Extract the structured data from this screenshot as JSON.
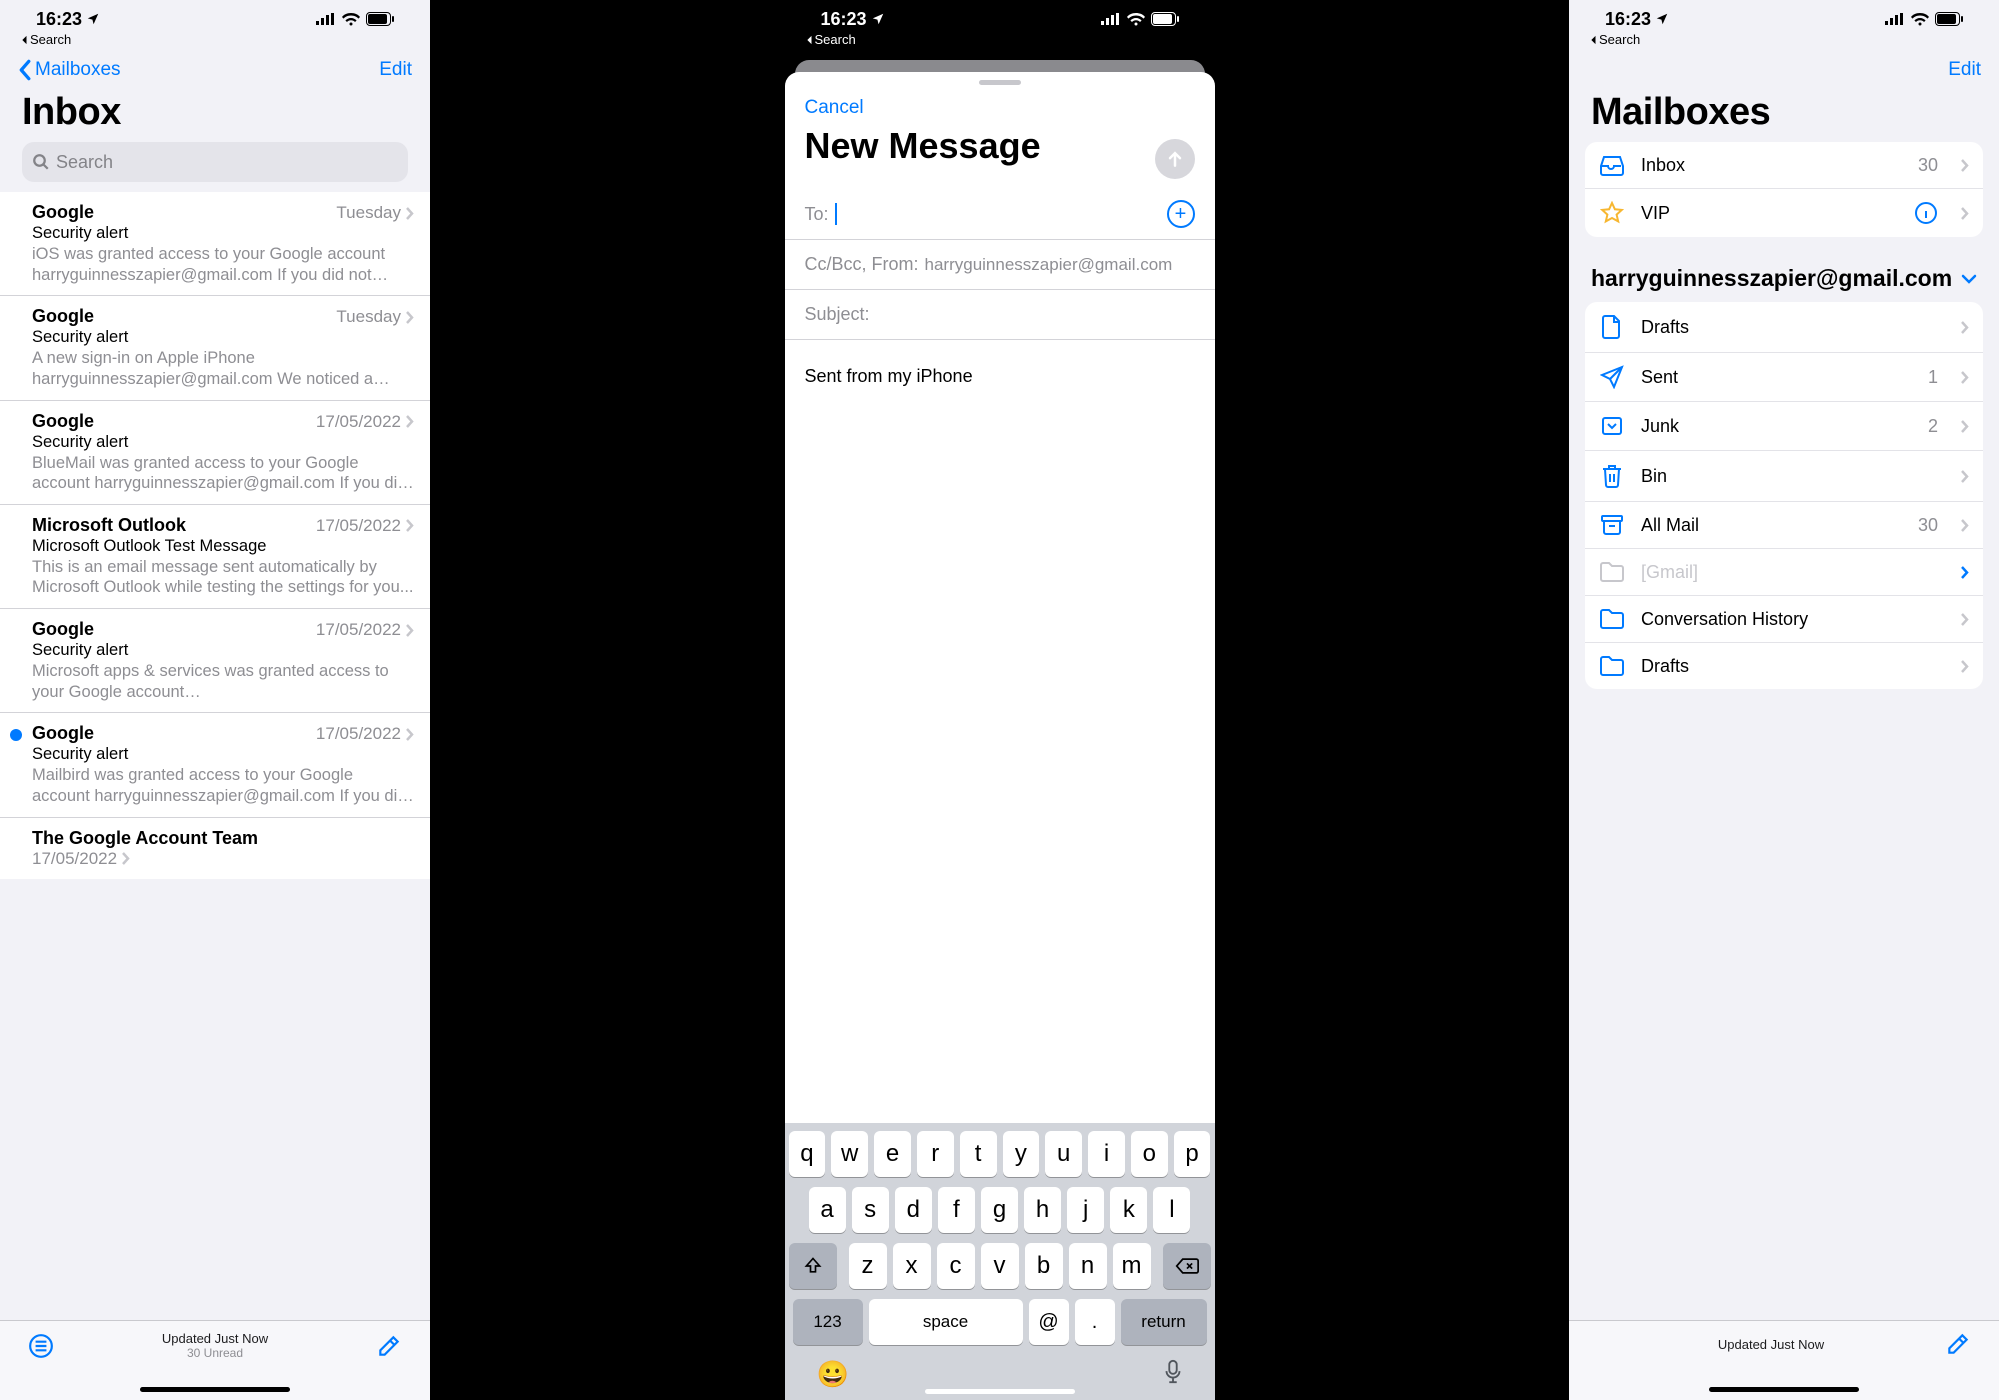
{
  "status": {
    "time": "16:23",
    "back": "Search"
  },
  "inbox": {
    "back": "Mailboxes",
    "edit": "Edit",
    "title": "Inbox",
    "search_placeholder": "Search",
    "toolbar": {
      "status": "Updated Just Now",
      "sub": "30 Unread"
    },
    "rows": [
      {
        "unread": false,
        "sender": "Google",
        "date": "Tuesday",
        "subject": "Security alert",
        "preview": "iOS was granted access to your Google account harryguinnesszapier@gmail.com If you did not gran..."
      },
      {
        "unread": false,
        "sender": "Google",
        "date": "Tuesday",
        "subject": "Security alert",
        "preview": "A new sign-in on Apple iPhone harryguinnesszapier@gmail.com We noticed a new..."
      },
      {
        "unread": false,
        "sender": "Google",
        "date": "17/05/2022",
        "subject": "Security alert",
        "preview": "BlueMail was granted access to your Google account harryguinnesszapier@gmail.com If you did not gran..."
      },
      {
        "unread": false,
        "sender": "Microsoft Outlook",
        "date": "17/05/2022",
        "subject": "Microsoft Outlook Test Message",
        "preview": "This is an email message sent automatically by Microsoft Outlook while testing the settings for you..."
      },
      {
        "unread": false,
        "sender": "Google",
        "date": "17/05/2022",
        "subject": "Security alert",
        "preview": "Microsoft apps & services was granted access to your Google account harryguinnesszapier@gmail.c..."
      },
      {
        "unread": true,
        "sender": "Google",
        "date": "17/05/2022",
        "subject": "Security alert",
        "preview": "Mailbird was granted access to your Google account harryguinnesszapier@gmail.com If you did not gran..."
      },
      {
        "unread": false,
        "sender": "The Google Account Team",
        "date": "17/05/2022",
        "subject": "",
        "preview": ""
      }
    ]
  },
  "compose": {
    "cancel": "Cancel",
    "title": "New Message",
    "to_label": "To:",
    "cc_label": "Cc/Bcc, From:",
    "from_value": "harryguinnesszapier@gmail.com",
    "subject_label": "Subject:",
    "body": "Sent from my iPhone",
    "keys_r1": [
      "q",
      "w",
      "e",
      "r",
      "t",
      "y",
      "u",
      "i",
      "o",
      "p"
    ],
    "keys_r2": [
      "a",
      "s",
      "d",
      "f",
      "g",
      "h",
      "j",
      "k",
      "l"
    ],
    "keys_r3": [
      "z",
      "x",
      "c",
      "v",
      "b",
      "n",
      "m"
    ],
    "key_123": "123",
    "key_space": "space",
    "key_at": "@",
    "key_dot": ".",
    "key_return": "return"
  },
  "mailboxes": {
    "edit": "Edit",
    "title": "Mailboxes",
    "top": [
      {
        "icon": "inbox",
        "label": "Inbox",
        "count": "30"
      },
      {
        "icon": "star",
        "label": "VIP",
        "info": true
      }
    ],
    "account": "harryguinnesszapier@gmail.com",
    "folders": [
      {
        "icon": "doc",
        "label": "Drafts",
        "count": ""
      },
      {
        "icon": "send",
        "label": "Sent",
        "count": "1"
      },
      {
        "icon": "junk",
        "label": "Junk",
        "count": "2"
      },
      {
        "icon": "trash",
        "label": "Bin",
        "count": ""
      },
      {
        "icon": "archive",
        "label": "All Mail",
        "count": "30"
      },
      {
        "icon": "folder",
        "label": "[Gmail]",
        "count": "",
        "muted": true,
        "bluechev": true
      },
      {
        "icon": "folder",
        "label": "Conversation History",
        "count": ""
      },
      {
        "icon": "folder",
        "label": "Drafts",
        "count": ""
      }
    ],
    "toolbar": {
      "status": "Updated Just Now"
    }
  }
}
